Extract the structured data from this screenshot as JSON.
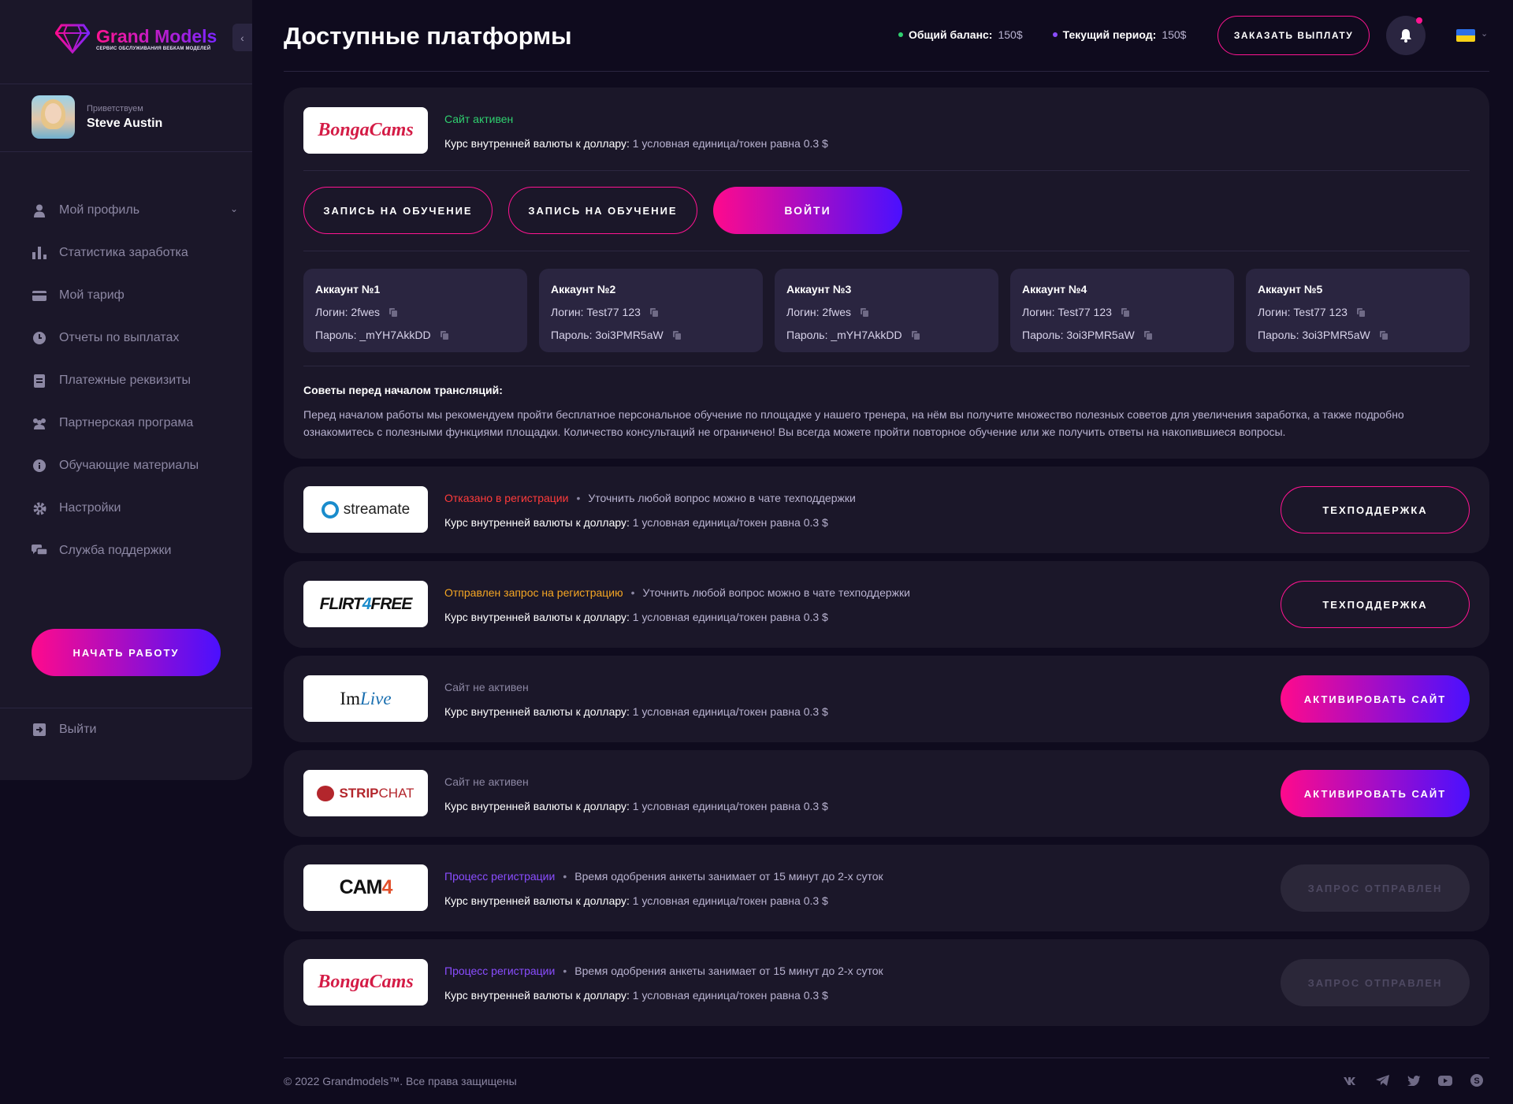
{
  "app": {
    "logo_title": "Grand Models",
    "logo_subtitle": "СЕРВИС ОБСЛУЖИВАНИЯ ВЕБКАМ МОДЕЛЕЙ",
    "brand_gradient": [
      "#ff0a8c",
      "#4a10ff"
    ]
  },
  "user": {
    "greeting": "Приветствуем",
    "name": "Steve Austin"
  },
  "sidebar": {
    "items": [
      {
        "label": "Мой профиль",
        "icon": "user-icon"
      },
      {
        "label": "Статистика заработка",
        "icon": "bar-chart-icon"
      },
      {
        "label": "Мой тариф",
        "icon": "credit-card-icon"
      },
      {
        "label": "Отчеты по выплатах",
        "icon": "clock-icon"
      },
      {
        "label": "Платежные реквизиты",
        "icon": "document-icon"
      },
      {
        "label": "Партнерская програма",
        "icon": "users-icon"
      },
      {
        "label": "Обучающие материалы",
        "icon": "info-icon"
      },
      {
        "label": "Настройки",
        "icon": "gear-icon"
      },
      {
        "label": "Служба поддержки",
        "icon": "chat-icon"
      }
    ],
    "start_label": "Начать работу",
    "logout_label": "Выйти"
  },
  "header": {
    "title": "Доступные платформы",
    "total_balance_label": "Общий баланс:",
    "total_balance_value": "150$",
    "period_label": "Текущий период:",
    "period_value": "150$",
    "payout_label": "ЗАКАЗАТЬ ВЫПЛАТУ",
    "language_flag": "ukraine-flag-icon"
  },
  "rate_label": "Курс внутренней валюты к доллару:",
  "rate_value": "1 условная единица/токен равна 0.3 $",
  "active_platform": {
    "name": "BongaCams",
    "status": "Сайт активен",
    "status_color": "#2fd06f",
    "btn_training_1": "Запись на обучение",
    "btn_training_2": "Запись на обучение",
    "btn_login": "Войти",
    "accounts": [
      {
        "title": "Аккаунт №1",
        "login": "Логин: 2fwes",
        "password": "Пароль: _mYH7AkkDD"
      },
      {
        "title": "Аккаунт №2",
        "login": "Логин: Test77 123",
        "password": "Пароль: 3oi3PMR5aW"
      },
      {
        "title": "Аккаунт №3",
        "login": "Логин: 2fwes",
        "password": "Пароль: _mYH7AkkDD"
      },
      {
        "title": "Аккаунт №4",
        "login": "Логин: Test77 123",
        "password": "Пароль: 3oi3PMR5aW"
      },
      {
        "title": "Аккаунт №5",
        "login": "Логин: Test77 123",
        "password": "Пароль: 3oi3PMR5aW"
      }
    ],
    "tips_title": "Советы перед началом трансляций:",
    "tips_text": "Перед началом работы мы рекомендуем пройти бесплатное персональное обучение по площадке у нашего тренера, на нём вы получите множество полезных советов для увеличения заработка, а также подробно ознакомитесь с полезными функциями площадки. Количество консультаций не ограничено! Вы всегда можете пройти повторное обучение или же получить ответы на накопившиеся вопросы."
  },
  "platforms": [
    {
      "name": "streamate",
      "status": "Отказано в регистрации",
      "status_color": "#ff3b3b",
      "note": "Уточнить любой вопрос можно в чате техподдержки",
      "button": "Техподдержка",
      "button_type": "outline"
    },
    {
      "name": "FLIRT4FREE",
      "status": "Отправлен запрос на регистрацию",
      "status_color": "#f5a623",
      "note": "Уточнить любой вопрос можно в чате техподдержки",
      "button": "Техподдержка",
      "button_type": "outline"
    },
    {
      "name": "ImLive",
      "status": "Сайт не активен",
      "status_color": "#8c87a3",
      "note": "",
      "button": "Активировать сайт",
      "button_type": "gradient"
    },
    {
      "name": "STRIPCHAT",
      "status": "Сайт не активен",
      "status_color": "#8c87a3",
      "note": "",
      "button": "Активировать сайт",
      "button_type": "gradient"
    },
    {
      "name": "CAM4",
      "status": "Процесс регистрации",
      "status_color": "#8a4dff",
      "note": "Время одобрения анкеты занимает от 15 минут до 2-х суток",
      "button": "Запрос отправлен",
      "button_type": "disabled"
    },
    {
      "name": "BongaCams",
      "status": "Процесс регистрации",
      "status_color": "#8a4dff",
      "note": "Время одобрения анкеты занимает от 15 минут до 2-х суток",
      "button": "Запрос отправлен",
      "button_type": "disabled"
    }
  ],
  "footer": {
    "copyright": "© 2022 Grandmodels™. Все права защищены",
    "socials": [
      "vk-icon",
      "telegram-icon",
      "twitter-icon",
      "youtube-icon",
      "skype-icon"
    ]
  }
}
